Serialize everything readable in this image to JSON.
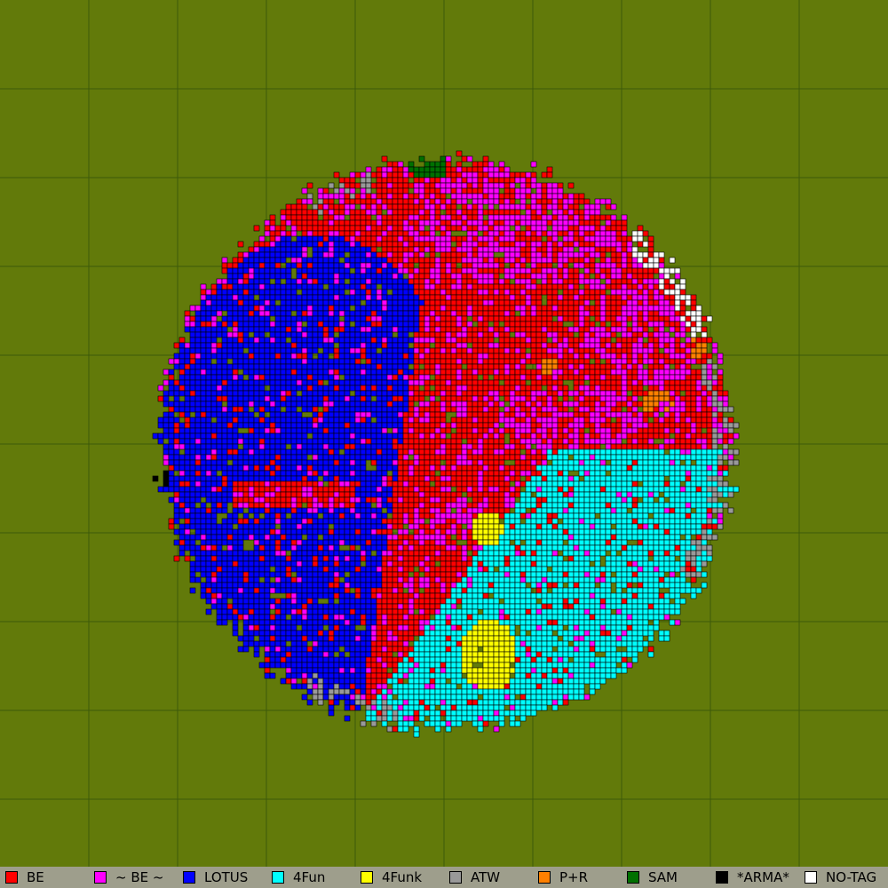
{
  "map": {
    "background_color": "#627a0a",
    "grid_color": "#3c5a0a",
    "grid_enabled": true
  },
  "legend": {
    "items": [
      {
        "label": "BE",
        "color": "#ff0000"
      },
      {
        "label": "~ BE ~",
        "color": "#ff00ff"
      },
      {
        "label": "LOTUS",
        "color": "#0000ff"
      },
      {
        "label": "4Fun",
        "color": "#00ffff"
      },
      {
        "label": "4Funk",
        "color": "#ffff00"
      },
      {
        "label": "ATW",
        "color": "#999999"
      },
      {
        "label": "P+R",
        "color": "#ff8000"
      },
      {
        "label": "SAM",
        "color": "#007000"
      },
      {
        "label": "*ARMA*",
        "color": "#000000"
      },
      {
        "label": "NO-TAG",
        "color": "#ffffff"
      }
    ]
  }
}
